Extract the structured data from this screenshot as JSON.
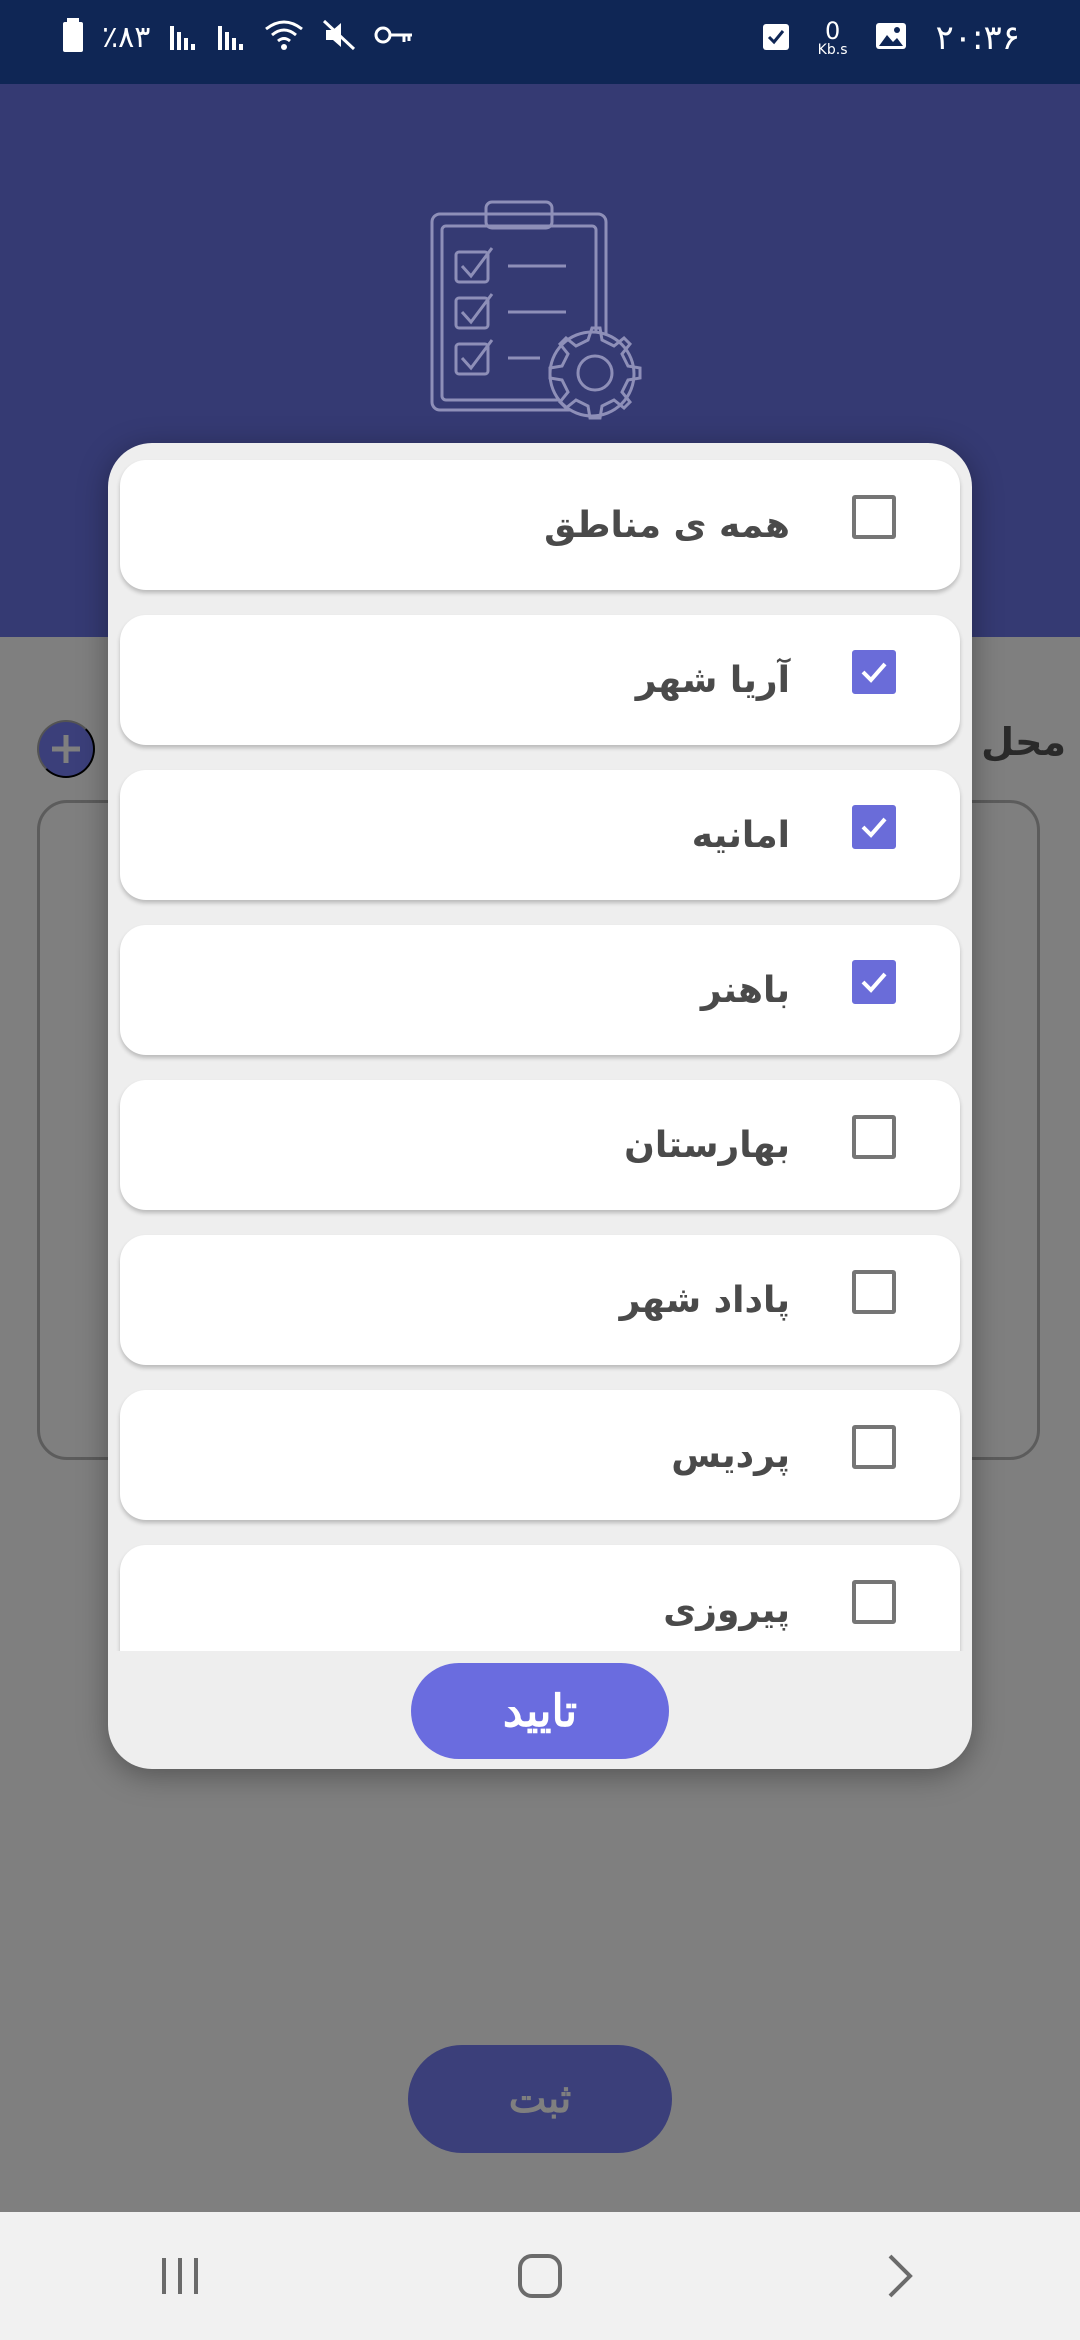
{
  "status_bar": {
    "time": "۲۰:۳۶",
    "speed_value": "0",
    "speed_unit": "Kb.s",
    "battery": "٪۸۳"
  },
  "page": {
    "place_label": "محل",
    "submit_label": "ثبت"
  },
  "dialog": {
    "items": [
      {
        "label": "همه ی مناطق",
        "checked": false
      },
      {
        "label": "آریا شهر",
        "checked": true
      },
      {
        "label": "امانیه",
        "checked": true
      },
      {
        "label": "باهنر",
        "checked": true
      },
      {
        "label": "بهارستان",
        "checked": false
      },
      {
        "label": "پاداد شهر",
        "checked": false
      },
      {
        "label": "پردیس",
        "checked": false
      },
      {
        "label": "پیروزی",
        "checked": false
      }
    ],
    "confirm_label": "تایید"
  },
  "colors": {
    "status_bar": "#0f2655",
    "header": "#353a73",
    "accent": "#6a6cdf",
    "overlay": "#7f7f7f"
  }
}
